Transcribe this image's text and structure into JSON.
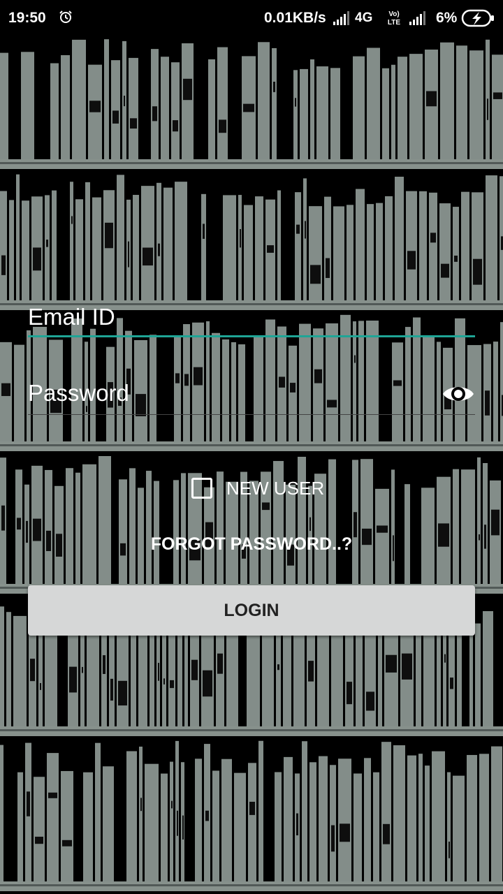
{
  "status_bar": {
    "time": "19:50",
    "alarm_icon": "alarm-clock-icon",
    "network_speed": "0.01KB/s",
    "network_type": "4G",
    "volte": "VoLTE",
    "battery_percent": "6%",
    "battery_icon": "battery-charging-icon"
  },
  "login_form": {
    "email_placeholder": "Email ID",
    "password_placeholder": "Password",
    "password_toggle_icon": "eye-icon",
    "new_user_label": "NEW USER",
    "new_user_checked": false,
    "forgot_password": "FORGOT PASSWORD..?",
    "login_button": "LOGIN"
  },
  "colors": {
    "accent": "#1fa596",
    "book_spine": "#96a19c",
    "shelf": "#9aa6a0",
    "button_bg": "#d6d7d7"
  },
  "background": {
    "description_icon": "bookshelf-background"
  }
}
